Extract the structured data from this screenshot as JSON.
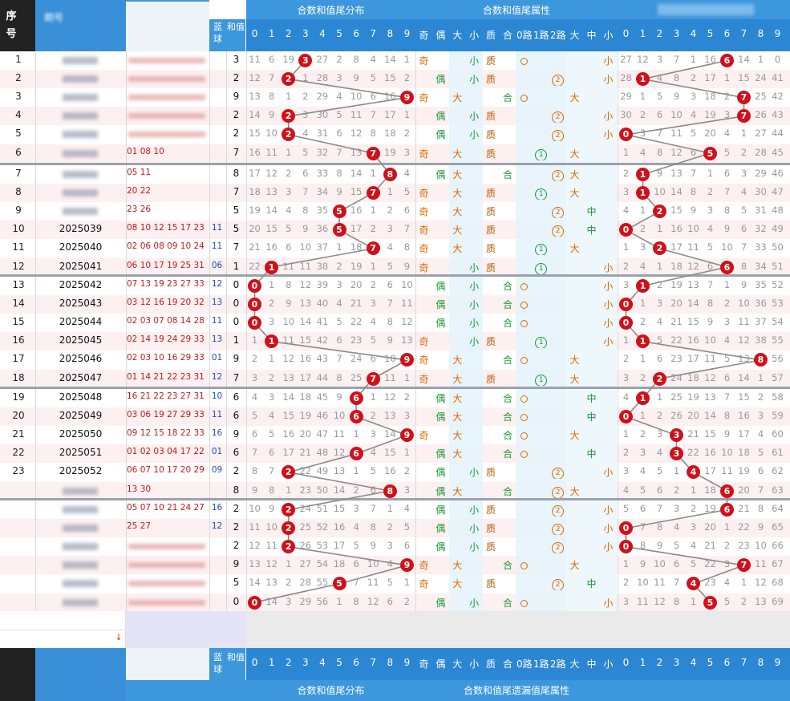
{
  "headers": {
    "seq_label": "序号",
    "period_label": "期号",
    "blue_label": "蓝球",
    "sum_label": "和值",
    "group1_top": "合数和值尾分布",
    "group2_top": "合数和值尾属性",
    "group1_bottom": "合数和值尾分布",
    "group2_bottom": "合数和值尾遗漏值尾属性",
    "digits": [
      "0",
      "1",
      "2",
      "3",
      "4",
      "5",
      "6",
      "7",
      "8",
      "9"
    ],
    "attrs": [
      "奇",
      "偶",
      "大",
      "小",
      "质",
      "合",
      "0路",
      "1路",
      "2路",
      "大",
      "中",
      "小"
    ]
  },
  "colors": {
    "ball": "#d0101a",
    "header_blue": "#3d97dd",
    "header_dark": "#222222",
    "row_alt": "#fdf0f0",
    "band": "#e4f3fb",
    "odd_text": "#e06a00",
    "even_text": "#1a9a3a",
    "prime_text": "#b85c00",
    "composite_text": "#1a9a3a",
    "line": "#8a8a8a"
  },
  "chart_data": {
    "type": "table",
    "rows": [
      {
        "seq": "1",
        "period": "",
        "reds": "",
        "blue": "",
        "val": 3,
        "dist": [
          11,
          6,
          19,
          null,
          27,
          2,
          8,
          4,
          14,
          1
        ],
        "oe": "奇",
        "size": "小",
        "pc": "质",
        "route": "0",
        "b3": "小",
        "miss": [
          27,
          12,
          3,
          7,
          1,
          16,
          null,
          14,
          1,
          0
        ]
      },
      {
        "seq": "2",
        "period": "",
        "reds": "",
        "blue": "",
        "val": 2,
        "dist": [
          12,
          7,
          null,
          1,
          28,
          3,
          9,
          5,
          15,
          2
        ],
        "oe": "偶",
        "size": "小",
        "pc": "质",
        "route": "2",
        "b3": "小",
        "miss": [
          28,
          null,
          4,
          8,
          2,
          17,
          1,
          15,
          24,
          41
        ]
      },
      {
        "seq": "3",
        "period": "",
        "reds": "",
        "blue": "",
        "val": 9,
        "dist": [
          13,
          8,
          1,
          2,
          29,
          4,
          10,
          6,
          16,
          null
        ],
        "oe": "奇",
        "size": "大",
        "pc": "合",
        "route": "0",
        "b3": "大",
        "miss": [
          29,
          1,
          5,
          9,
          3,
          18,
          2,
          null,
          25,
          42
        ]
      },
      {
        "seq": "4",
        "period": "",
        "reds": "",
        "blue": "",
        "val": 2,
        "dist": [
          14,
          9,
          null,
          3,
          30,
          5,
          11,
          7,
          17,
          1
        ],
        "oe": "偶",
        "size": "小",
        "pc": "质",
        "route": "2",
        "b3": "小",
        "miss": [
          30,
          2,
          6,
          10,
          4,
          19,
          3,
          null,
          26,
          43
        ]
      },
      {
        "seq": "5",
        "period": "",
        "reds": "",
        "blue": "",
        "val": 2,
        "dist": [
          15,
          10,
          null,
          4,
          31,
          6,
          12,
          8,
          18,
          2
        ],
        "oe": "偶",
        "size": "小",
        "pc": "质",
        "route": "2",
        "b3": "小",
        "miss": [
          null,
          3,
          7,
          11,
          5,
          20,
          4,
          1,
          27,
          44
        ]
      },
      {
        "seq": "6",
        "period": "",
        "reds": "01 08 10",
        "blue": "",
        "val": 7,
        "dist": [
          16,
          11,
          1,
          5,
          32,
          7,
          13,
          null,
          19,
          3
        ],
        "oe": "奇",
        "size": "大",
        "pc": "质",
        "route": "1",
        "b3": "大",
        "miss": [
          1,
          4,
          8,
          12,
          6,
          null,
          5,
          2,
          28,
          45
        ]
      },
      {
        "seq": "7",
        "period": "",
        "reds": "05 11",
        "blue": "",
        "val": 8,
        "dist": [
          17,
          12,
          2,
          6,
          33,
          8,
          14,
          1,
          null,
          4
        ],
        "oe": "偶",
        "size": "大",
        "pc": "合",
        "route": "2",
        "b3": "大",
        "miss": [
          2,
          null,
          9,
          13,
          7,
          1,
          6,
          3,
          29,
          46
        ]
      },
      {
        "seq": "8",
        "period": "",
        "reds": "20 22",
        "blue": "",
        "val": 7,
        "dist": [
          18,
          13,
          3,
          7,
          34,
          9,
          15,
          null,
          1,
          5
        ],
        "oe": "奇",
        "size": "大",
        "pc": "质",
        "route": "1",
        "b3": "大",
        "miss": [
          3,
          null,
          10,
          14,
          8,
          2,
          7,
          4,
          30,
          47
        ]
      },
      {
        "seq": "9",
        "period": "",
        "reds": "23 26",
        "blue": "",
        "val": 5,
        "dist": [
          19,
          14,
          4,
          8,
          35,
          null,
          16,
          1,
          2,
          6
        ],
        "oe": "奇",
        "size": "大",
        "pc": "质",
        "route": "2",
        "b3": "中",
        "miss": [
          4,
          1,
          null,
          15,
          9,
          3,
          8,
          5,
          31,
          48
        ]
      },
      {
        "seq": "10",
        "period": "2025039",
        "reds": "08 10 12 15 17 23",
        "blue": "11",
        "val": 5,
        "dist": [
          20,
          15,
          5,
          9,
          36,
          null,
          17,
          2,
          3,
          7
        ],
        "oe": "奇",
        "size": "大",
        "pc": "质",
        "route": "2",
        "b3": "中",
        "miss": [
          null,
          2,
          1,
          16,
          10,
          4,
          9,
          6,
          32,
          49
        ]
      },
      {
        "seq": "11",
        "period": "2025040",
        "reds": "02 06 08 09 10 24",
        "blue": "11",
        "val": 7,
        "dist": [
          21,
          16,
          6,
          10,
          37,
          1,
          18,
          null,
          4,
          8
        ],
        "oe": "奇",
        "size": "大",
        "pc": "质",
        "route": "1",
        "b3": "大",
        "miss": [
          1,
          3,
          null,
          17,
          11,
          5,
          10,
          7,
          33,
          50
        ]
      },
      {
        "seq": "12",
        "period": "2025041",
        "reds": "06 10 17 19 25 31",
        "blue": "06",
        "val": 1,
        "dist": [
          22,
          null,
          11,
          11,
          38,
          2,
          19,
          1,
          5,
          9
        ],
        "oe": "奇",
        "size": "小",
        "pc": "质",
        "route": "1",
        "b3": "小",
        "miss": [
          2,
          4,
          1,
          18,
          12,
          6,
          null,
          8,
          34,
          51
        ]
      },
      {
        "seq": "13",
        "period": "2025042",
        "reds": "07 13 19 23 27 33",
        "blue": "12",
        "val": 0,
        "dist": [
          null,
          1,
          8,
          12,
          39,
          3,
          20,
          2,
          6,
          10
        ],
        "oe": "偶",
        "size": "小",
        "pc": "合",
        "route": "0",
        "b3": "小",
        "miss": [
          3,
          null,
          2,
          19,
          13,
          7,
          1,
          9,
          35,
          52
        ]
      },
      {
        "seq": "14",
        "period": "2025043",
        "reds": "03 12 16 19 20 32",
        "blue": "13",
        "val": 0,
        "dist": [
          null,
          2,
          9,
          13,
          40,
          4,
          21,
          3,
          7,
          11
        ],
        "oe": "偶",
        "size": "小",
        "pc": "合",
        "route": "0",
        "b3": "小",
        "miss": [
          null,
          1,
          3,
          20,
          14,
          8,
          2,
          10,
          36,
          53
        ]
      },
      {
        "seq": "15",
        "period": "2025044",
        "reds": "02 03 07 08 14 28",
        "blue": "11",
        "val": 0,
        "dist": [
          null,
          3,
          10,
          14,
          41,
          5,
          22,
          4,
          8,
          12
        ],
        "oe": "偶",
        "size": "小",
        "pc": "合",
        "route": "0",
        "b3": "小",
        "miss": [
          null,
          2,
          4,
          21,
          15,
          9,
          3,
          11,
          37,
          54
        ]
      },
      {
        "seq": "16",
        "period": "2025045",
        "reds": "02 14 19 24 29 33",
        "blue": "13",
        "val": 1,
        "dist": [
          1,
          null,
          11,
          15,
          42,
          6,
          23,
          5,
          9,
          13
        ],
        "oe": "奇",
        "size": "小",
        "pc": "质",
        "route": "1",
        "b3": "小",
        "miss": [
          1,
          null,
          5,
          22,
          16,
          10,
          4,
          12,
          38,
          55
        ]
      },
      {
        "seq": "17",
        "period": "2025046",
        "reds": "02 03 10 16 29 33",
        "blue": "01",
        "val": 9,
        "dist": [
          2,
          1,
          12,
          16,
          43,
          7,
          24,
          6,
          10,
          null
        ],
        "oe": "奇",
        "size": "大",
        "pc": "合",
        "route": "0",
        "b3": "大",
        "miss": [
          2,
          1,
          6,
          23,
          17,
          11,
          5,
          13,
          null,
          56
        ]
      },
      {
        "seq": "18",
        "period": "2025047",
        "reds": "01 14 21 22 23 31",
        "blue": "12",
        "val": 7,
        "dist": [
          3,
          2,
          13,
          17,
          44,
          8,
          25,
          null,
          11,
          1
        ],
        "oe": "奇",
        "size": "大",
        "pc": "质",
        "route": "1",
        "b3": "大",
        "miss": [
          3,
          2,
          null,
          24,
          18,
          12,
          6,
          14,
          1,
          57
        ]
      },
      {
        "seq": "19",
        "period": "2025048",
        "reds": "16 21 22 23 27 31",
        "blue": "10",
        "val": 6,
        "dist": [
          4,
          3,
          14,
          18,
          45,
          9,
          null,
          1,
          12,
          2
        ],
        "oe": "偶",
        "size": "大",
        "pc": "合",
        "route": "0",
        "b3": "中",
        "miss": [
          4,
          null,
          1,
          25,
          19,
          13,
          7,
          15,
          2,
          58
        ]
      },
      {
        "seq": "20",
        "period": "2025049",
        "reds": "03 06 19 27 29 33",
        "blue": "11",
        "val": 6,
        "dist": [
          5,
          4,
          15,
          19,
          46,
          10,
          null,
          2,
          13,
          3
        ],
        "oe": "偶",
        "size": "大",
        "pc": "合",
        "route": "0",
        "b3": "中",
        "miss": [
          null,
          1,
          2,
          26,
          20,
          14,
          8,
          16,
          3,
          59
        ]
      },
      {
        "seq": "21",
        "period": "2025050",
        "reds": "09 12 15 18 22 33",
        "blue": "16",
        "val": 9,
        "dist": [
          6,
          5,
          16,
          20,
          47,
          11,
          1,
          3,
          14,
          null
        ],
        "oe": "奇",
        "size": "大",
        "pc": "合",
        "route": "0",
        "b3": "大",
        "miss": [
          1,
          2,
          3,
          null,
          21,
          15,
          9,
          17,
          4,
          60
        ]
      },
      {
        "seq": "22",
        "period": "2025051",
        "reds": "01 02 03 04 17 22",
        "blue": "01",
        "val": 6,
        "dist": [
          7,
          6,
          17,
          21,
          48,
          12,
          null,
          4,
          15,
          1
        ],
        "oe": "偶",
        "size": "大",
        "pc": "合",
        "route": "0",
        "b3": "中",
        "miss": [
          2,
          3,
          4,
          null,
          22,
          16,
          10,
          18,
          5,
          61
        ]
      },
      {
        "seq": "23",
        "period": "2025052",
        "reds": "06 07 10 17 20 29",
        "blue": "09",
        "val": 2,
        "dist": [
          8,
          7,
          null,
          22,
          49,
          13,
          1,
          5,
          16,
          2
        ],
        "oe": "偶",
        "size": "小",
        "pc": "质",
        "route": "2",
        "b3": "小",
        "miss": [
          3,
          4,
          5,
          1,
          null,
          17,
          11,
          19,
          6,
          62
        ]
      },
      {
        "seq": "",
        "period": "",
        "reds": "13 30",
        "blue": "",
        "val": 8,
        "dist": [
          9,
          8,
          1,
          23,
          50,
          14,
          2,
          6,
          null,
          3
        ],
        "oe": "偶",
        "size": "大",
        "pc": "合",
        "route": "2",
        "b3": "大",
        "miss": [
          4,
          5,
          6,
          2,
          1,
          18,
          null,
          20,
          7,
          63
        ]
      },
      {
        "seq": "",
        "period": "",
        "reds": "05 07 10 21 24 27",
        "blue": "16",
        "val": 2,
        "dist": [
          10,
          9,
          null,
          24,
          51,
          15,
          3,
          7,
          1,
          4
        ],
        "oe": "偶",
        "size": "小",
        "pc": "质",
        "route": "2",
        "b3": "小",
        "miss": [
          5,
          6,
          7,
          3,
          2,
          19,
          null,
          21,
          8,
          64
        ]
      },
      {
        "seq": "",
        "period": "",
        "reds": "25 27",
        "blue": "12",
        "val": 2,
        "dist": [
          11,
          10,
          null,
          25,
          52,
          16,
          4,
          8,
          2,
          5
        ],
        "oe": "偶",
        "size": "小",
        "pc": "质",
        "route": "2",
        "b3": "小",
        "miss": [
          null,
          7,
          8,
          4,
          3,
          20,
          1,
          22,
          9,
          65
        ]
      },
      {
        "seq": "",
        "period": "",
        "reds": "",
        "blue": "",
        "val": 2,
        "dist": [
          12,
          11,
          null,
          26,
          53,
          17,
          5,
          9,
          3,
          6
        ],
        "oe": "偶",
        "size": "小",
        "pc": "质",
        "route": "2",
        "b3": "小",
        "miss": [
          null,
          8,
          9,
          5,
          4,
          21,
          2,
          23,
          10,
          66
        ]
      },
      {
        "seq": "",
        "period": "",
        "reds": "",
        "blue": "",
        "val": 9,
        "dist": [
          13,
          12,
          1,
          27,
          54,
          18,
          6,
          10,
          4,
          null
        ],
        "oe": "奇",
        "size": "大",
        "pc": "合",
        "route": "0",
        "b3": "大",
        "miss": [
          1,
          9,
          10,
          6,
          5,
          22,
          3,
          null,
          11,
          67
        ]
      },
      {
        "seq": "",
        "period": "",
        "reds": "",
        "blue": "",
        "val": 5,
        "dist": [
          14,
          13,
          2,
          28,
          55,
          null,
          7,
          11,
          5,
          1
        ],
        "oe": "奇",
        "size": "大",
        "pc": "质",
        "route": "2",
        "b3": "中",
        "miss": [
          2,
          10,
          11,
          7,
          null,
          23,
          4,
          1,
          12,
          68
        ]
      },
      {
        "seq": "",
        "period": "",
        "reds": "",
        "blue": "",
        "val": 0,
        "dist": [
          null,
          14,
          3,
          29,
          56,
          1,
          8,
          12,
          6,
          2
        ],
        "oe": "偶",
        "size": "小",
        "pc": "合",
        "route": "0",
        "b3": "小",
        "miss": [
          3,
          11,
          12,
          8,
          1,
          null,
          5,
          2,
          13,
          69
        ]
      }
    ]
  }
}
